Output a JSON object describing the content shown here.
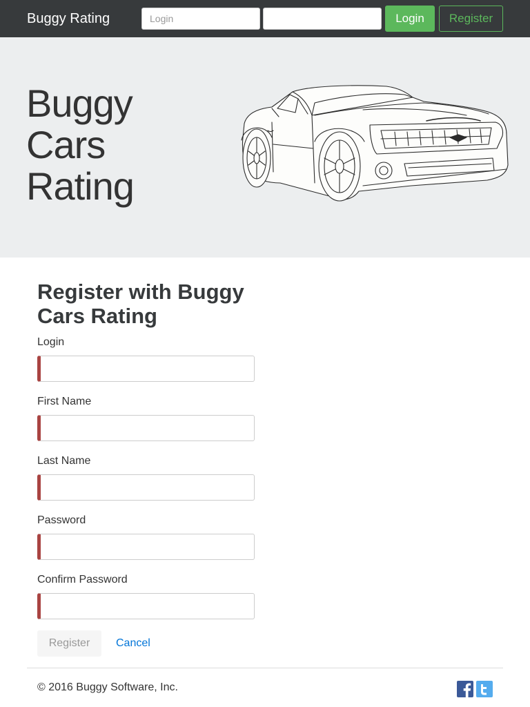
{
  "navbar": {
    "brand": "Buggy Rating",
    "login_placeholder": "Login",
    "password_placeholder": "",
    "login_button": "Login",
    "register_button": "Register"
  },
  "jumbotron": {
    "title_lines": [
      "Buggy",
      "Cars",
      "Rating"
    ],
    "image": "sports-car-line-drawing"
  },
  "form": {
    "title": "Register with Buggy Cars Rating",
    "fields": [
      {
        "label": "Login",
        "value": ""
      },
      {
        "label": "First Name",
        "value": ""
      },
      {
        "label": "Last Name",
        "value": ""
      },
      {
        "label": "Password",
        "value": ""
      },
      {
        "label": "Confirm Password",
        "value": ""
      }
    ],
    "register_button": "Register",
    "cancel_link": "Cancel"
  },
  "footer": {
    "copyright": "© 2016 Buggy Software, Inc.",
    "social": [
      "facebook-icon",
      "twitter-icon"
    ]
  },
  "colors": {
    "navbar_bg": "#373a3c",
    "jumbotron_bg": "#eceeef",
    "success_green": "#5cb85c",
    "invalid_red": "#a94442",
    "link_blue": "#0275d8",
    "facebook_blue": "#3b5998",
    "twitter_blue": "#55acee"
  }
}
